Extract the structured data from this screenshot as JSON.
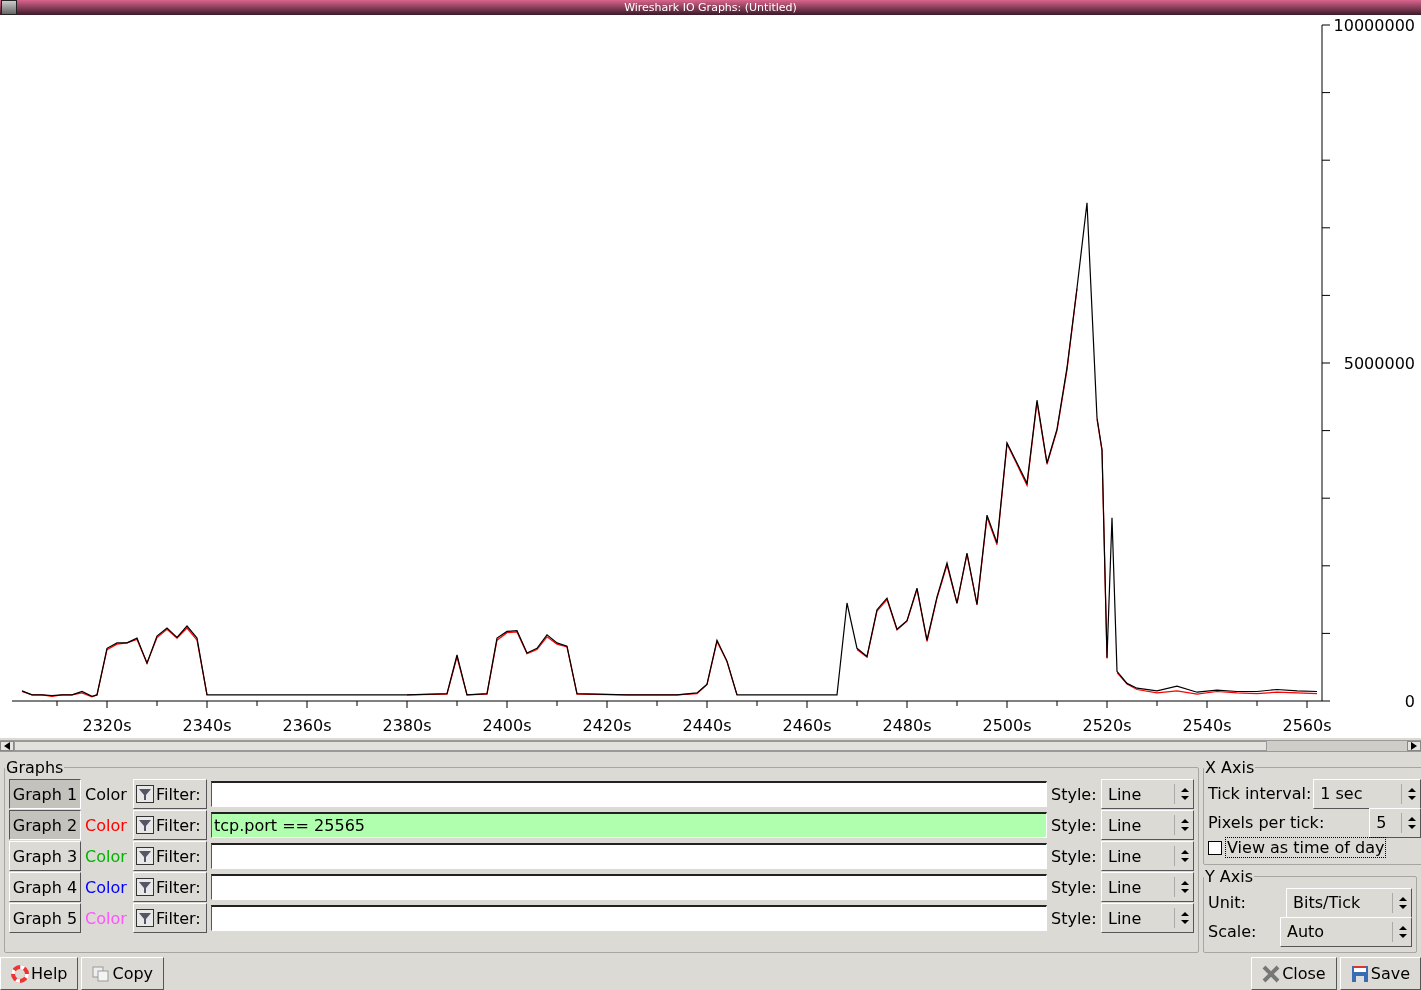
{
  "window": {
    "title": "Wireshark IO Graphs: (Untitled)"
  },
  "chart": {
    "chart_data": {
      "type": "line",
      "x": [
        2303,
        2305,
        2307,
        2309,
        2311,
        2313,
        2315,
        2317,
        2318,
        2320,
        2322,
        2324,
        2326,
        2328,
        2330,
        2332,
        2334,
        2336,
        2338,
        2340,
        2350,
        2360,
        2370,
        2380,
        2388,
        2390,
        2392,
        2396,
        2398,
        2400,
        2402,
        2404,
        2406,
        2408,
        2410,
        2412,
        2414,
        2424,
        2434,
        2438,
        2440,
        2442,
        2444,
        2446,
        2456,
        2466,
        2468,
        2470,
        2472,
        2474,
        2476,
        2478,
        2480,
        2482,
        2484,
        2486,
        2488,
        2490,
        2492,
        2494,
        2496,
        2498,
        2500,
        2502,
        2504,
        2506,
        2508,
        2510,
        2512,
        2514,
        2516,
        2518,
        2519,
        2520,
        2521,
        2522,
        2524,
        2526,
        2530,
        2534,
        2538,
        2542,
        2546,
        2550,
        2554,
        2558,
        2562
      ],
      "series": [
        {
          "color": "#ff0000",
          "values": [
            140000,
            90000,
            90000,
            70000,
            90000,
            90000,
            120000,
            60000,
            90000,
            760000,
            840000,
            860000,
            910000,
            560000,
            940000,
            1060000,
            930000,
            1080000,
            900000,
            90000,
            null,
            null,
            null,
            90000,
            100000,
            650000,
            90000,
            100000,
            900000,
            1010000,
            1020000,
            700000,
            760000,
            950000,
            840000,
            800000,
            100000,
            90000,
            90000,
            110000,
            240000,
            880000,
            580000,
            90000,
            null,
            null,
            null,
            760000,
            650000,
            1330000,
            1500000,
            1050000,
            1180000,
            1650000,
            880000,
            1520000,
            2010000,
            1440000,
            2170000,
            1420000,
            2720000,
            2310000,
            3800000,
            3500000,
            3190000,
            4420000,
            3500000,
            4000000,
            4900000,
            6100000,
            null,
            4170000,
            3700000,
            630000,
            null,
            420000,
            250000,
            170000,
            120000,
            150000,
            100000,
            140000,
            120000,
            110000,
            130000,
            120000,
            110000
          ]
        },
        {
          "color": "#000000",
          "values": [
            150000,
            90000,
            90000,
            80000,
            90000,
            90000,
            140000,
            70000,
            90000,
            780000,
            860000,
            860000,
            930000,
            560000,
            960000,
            1080000,
            940000,
            1110000,
            930000,
            90000,
            90000,
            90000,
            90000,
            90000,
            110000,
            680000,
            90000,
            110000,
            930000,
            1030000,
            1040000,
            710000,
            780000,
            980000,
            860000,
            810000,
            110000,
            90000,
            90000,
            120000,
            250000,
            900000,
            590000,
            90000,
            90000,
            90000,
            1450000,
            780000,
            660000,
            1350000,
            1520000,
            1060000,
            1190000,
            1670000,
            900000,
            1540000,
            2040000,
            1450000,
            2190000,
            1430000,
            2750000,
            2340000,
            3820000,
            3520000,
            3220000,
            4450000,
            3520000,
            4020000,
            4930000,
            6110000,
            7370000,
            4190000,
            3720000,
            640000,
            2710000,
            440000,
            260000,
            190000,
            150000,
            220000,
            130000,
            160000,
            140000,
            140000,
            170000,
            150000,
            140000
          ]
        }
      ],
      "xlim": [
        2301,
        2563
      ],
      "ylim": [
        0,
        10000000
      ],
      "xticks": [
        {
          "value": 2320,
          "label": "2320s"
        },
        {
          "value": 2340,
          "label": "2340s"
        },
        {
          "value": 2360,
          "label": "2360s"
        },
        {
          "value": 2380,
          "label": "2380s"
        },
        {
          "value": 2400,
          "label": "2400s"
        },
        {
          "value": 2420,
          "label": "2420s"
        },
        {
          "value": 2440,
          "label": "2440s"
        },
        {
          "value": 2460,
          "label": "2460s"
        },
        {
          "value": 2480,
          "label": "2480s"
        },
        {
          "value": 2500,
          "label": "2500s"
        },
        {
          "value": 2520,
          "label": "2520s"
        },
        {
          "value": 2540,
          "label": "2540s"
        },
        {
          "value": 2560,
          "label": "2560s"
        }
      ],
      "yticks": [
        0,
        5000000,
        10000000
      ]
    }
  },
  "graphs": {
    "title": "Graphs",
    "rows": [
      {
        "label": "Graph 1",
        "selected": true,
        "color_label": "Color",
        "color": "#000000",
        "filter_button": "Filter:",
        "style_label": "Style:",
        "style": "Line"
      },
      {
        "label": "Graph 2",
        "selected": true,
        "color_label": "Color",
        "color": "#ff0000",
        "filter_button": "Filter:",
        "filter": "tcp.port == 25565",
        "style_label": "Style:",
        "style": "Line"
      },
      {
        "label": "Graph 3",
        "selected": false,
        "color_label": "Color",
        "color": "#00b400",
        "filter_button": "Filter:",
        "style_label": "Style:",
        "style": "Line"
      },
      {
        "label": "Graph 4",
        "selected": false,
        "color_label": "Color",
        "color": "#0000ff",
        "filter_button": "Filter:",
        "style_label": "Style:",
        "style": "Line"
      },
      {
        "label": "Graph 5",
        "selected": false,
        "color_label": "Color",
        "color": "#ff55ff",
        "filter_button": "Filter:",
        "style_label": "Style:",
        "style": "Line"
      }
    ]
  },
  "x_axis": {
    "title": "X Axis",
    "tick_interval_label": "Tick interval:",
    "tick_interval": "1 sec",
    "pixels_label": "Pixels per tick:",
    "pixels": "5",
    "time_of_day": {
      "label": "View as time of day",
      "checked": false
    }
  },
  "y_axis": {
    "title": "Y Axis",
    "unit_label": "Unit:",
    "unit": "Bits/Tick",
    "scale_label": "Scale:",
    "scale": "Auto"
  },
  "buttons": [
    {
      "label": "Help",
      "kind": "help"
    },
    {
      "label": "Copy",
      "kind": "copy"
    },
    {
      "label": "Close",
      "kind": "close"
    },
    {
      "label": "Save",
      "kind": "save"
    }
  ]
}
